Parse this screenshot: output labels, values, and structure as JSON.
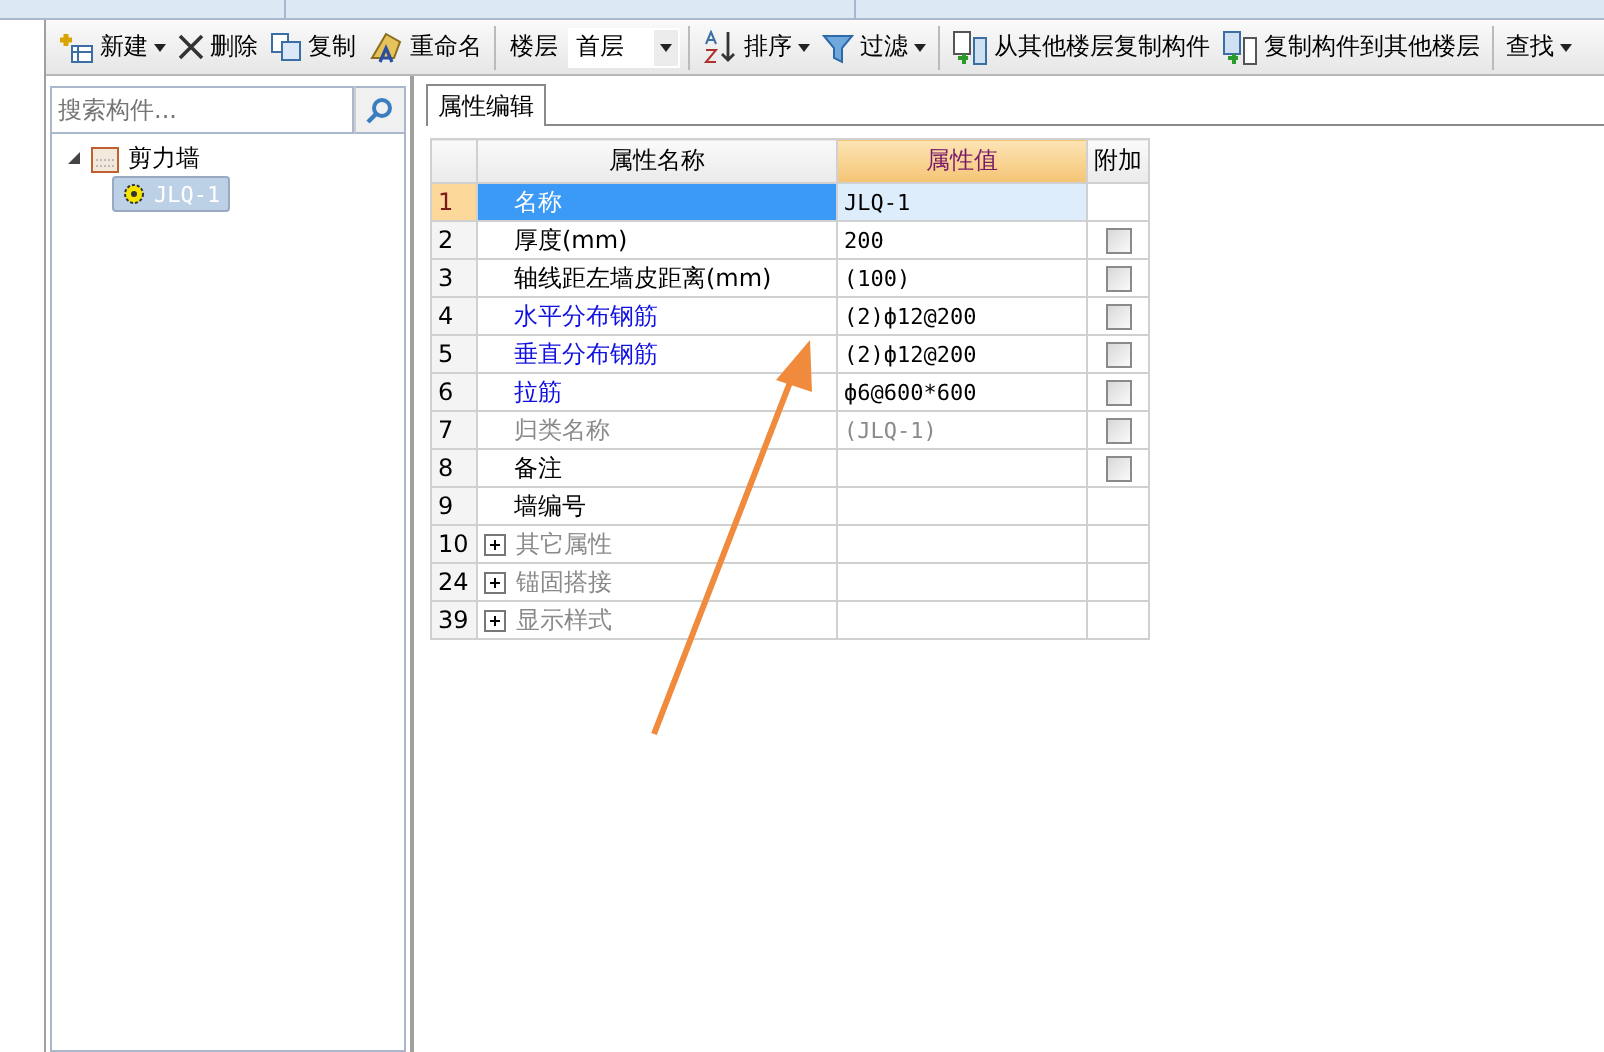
{
  "toolbar": {
    "items": [
      {
        "kind": "new",
        "label": "新建",
        "menu": true
      },
      {
        "kind": "delete",
        "label": "删除",
        "menu": false
      },
      {
        "kind": "copy",
        "label": "复制",
        "menu": false
      },
      {
        "kind": "rename",
        "label": "重命名",
        "menu": false
      },
      {
        "kind": "floor",
        "label": "楼层",
        "value": "首层"
      },
      {
        "kind": "sort",
        "label": "排序",
        "menu": true
      },
      {
        "kind": "filter",
        "label": "过滤",
        "menu": true
      },
      {
        "kind": "copyfrom",
        "label": "从其他楼层复制构件",
        "menu": false
      },
      {
        "kind": "copyto",
        "label": "复制构件到其他楼层",
        "menu": false
      },
      {
        "kind": "find",
        "label": "查找",
        "menu": true
      }
    ]
  },
  "sidebar": {
    "search": {
      "placeholder": "搜索构件..."
    },
    "tree": [
      {
        "label": "剪力墙",
        "expanded": true,
        "selected": false,
        "children": [
          {
            "label": "JLQ-1",
            "selected": true
          }
        ]
      }
    ]
  },
  "tabs": [
    {
      "label": "属性编辑",
      "selected": true
    }
  ],
  "table": {
    "columns": [
      "属性名称",
      "属性值",
      "附加"
    ],
    "rows": [
      {
        "num": "1",
        "name": "名称",
        "value": "JLQ-1",
        "kind": "normal",
        "selected": true
      },
      {
        "num": "2",
        "name": "厚度(mm)",
        "value": "200",
        "kind": "normal",
        "selected": false,
        "checked": false
      },
      {
        "num": "3",
        "name": "轴线距左墙皮距离(mm)",
        "value": "(100)",
        "kind": "normal",
        "selected": false,
        "checked": false
      },
      {
        "num": "4",
        "name": "水平分布钢筋",
        "value": "(2)ф12@200",
        "kind": "link",
        "selected": false,
        "checked": false
      },
      {
        "num": "5",
        "name": "垂直分布钢筋",
        "value": "(2)ф12@200",
        "kind": "link",
        "selected": false,
        "checked": false
      },
      {
        "num": "6",
        "name": "拉筋",
        "value": "ф6@600*600",
        "kind": "link",
        "selected": false,
        "checked": false
      },
      {
        "num": "7",
        "name": "归类名称",
        "value": "(JLQ-1)",
        "kind": "muted",
        "selected": false,
        "checked": false
      },
      {
        "num": "8",
        "name": "备注",
        "value": "",
        "kind": "normal",
        "selected": false,
        "checked": false
      },
      {
        "num": "9",
        "name": "墙编号",
        "kind": "normal",
        "selected": false
      },
      {
        "num": "10",
        "name": "其它属性",
        "kind": "group",
        "selected": false,
        "expanded": false
      },
      {
        "num": "24",
        "name": "锚固搭接",
        "kind": "group",
        "selected": false,
        "expanded": false
      },
      {
        "num": "39",
        "name": "显示样式",
        "kind": "group",
        "selected": false,
        "expanded": false
      }
    ]
  }
}
